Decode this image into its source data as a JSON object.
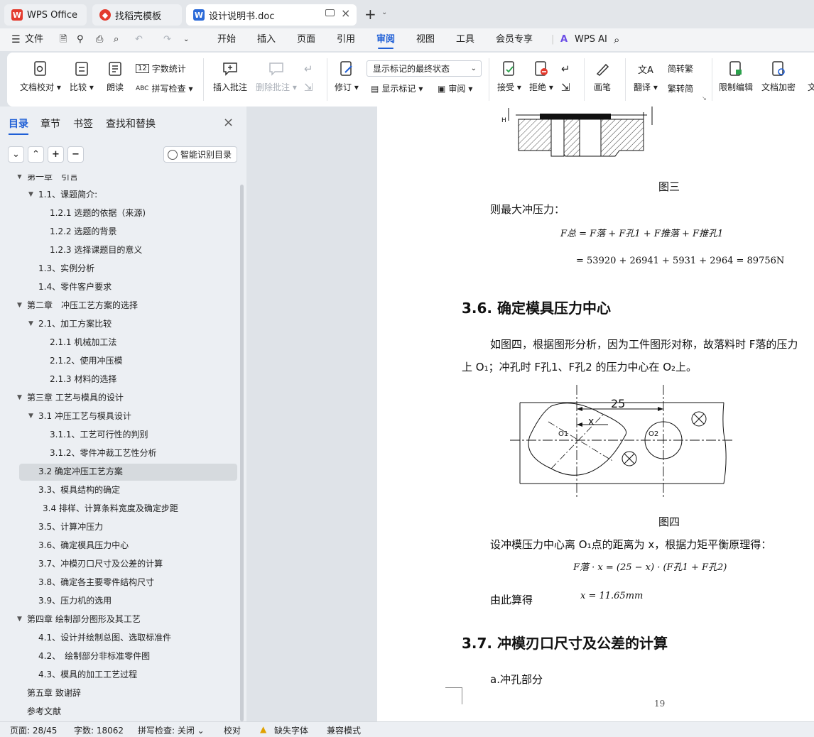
{
  "tabs": [
    {
      "label": "WPS Office"
    },
    {
      "label": "找稻壳模板"
    },
    {
      "label": "设计说明书.doc"
    }
  ],
  "menu": {
    "file": "文件",
    "items": [
      "开始",
      "插入",
      "页面",
      "引用",
      "审阅",
      "视图",
      "工具",
      "会员专享"
    ],
    "active": "审阅",
    "wps_ai": "WPS AI"
  },
  "ribbon": {
    "doc_check": "文档校对",
    "compare": "比较",
    "read_aloud": "朗读",
    "word_count": "字数统计",
    "spell_check": "拼写检查",
    "insert_comment": "插入批注",
    "delete_comment": "删除批注",
    "revise": "修订",
    "markup_state": "显示标记的最终状态",
    "show_markup": "显示标记",
    "review": "审阅",
    "accept": "接受",
    "reject": "拒绝",
    "pen": "画笔",
    "translate": "翻译",
    "to_traditional": "简转繁",
    "to_simplified": "繁转简",
    "restrict_edit": "限制编辑",
    "doc_encrypt": "文档加密",
    "more_cut": "文"
  },
  "nav_pane": {
    "tabs": [
      "目录",
      "章节",
      "书签",
      "查找和替换"
    ],
    "smart_toc": "智能识别目录",
    "toc": [
      {
        "label": "第一章　引言"
      },
      {
        "label": "1.1、课题简介:"
      },
      {
        "label": "1.2.1 选题的依据（来源)"
      },
      {
        "label": "1.2.2 选题的背景"
      },
      {
        "label": "1.2.3 选择课题目的意义"
      },
      {
        "label": "1.3、实例分析"
      },
      {
        "label": "1.4、零件客户要求"
      },
      {
        "label": "第二章　冲压工艺方案的选择"
      },
      {
        "label": "2.1、加工方案比较"
      },
      {
        "label": "2.1.1 机械加工法"
      },
      {
        "label": "2.1.2、使用冲压模"
      },
      {
        "label": "2.1.3 材料的选择"
      },
      {
        "label": "第三章 工艺与模具的设计"
      },
      {
        "label": "3.1 冲压工艺与模具设计"
      },
      {
        "label": "3.1.1、工艺可行性的判别"
      },
      {
        "label": "3.1.2、零件冲裁工艺性分析"
      },
      {
        "label": "3.2 确定冲压工艺方案"
      },
      {
        "label": "3.3、模具结构的确定"
      },
      {
        "label": "3.4 排样、计算条料宽度及确定步距"
      },
      {
        "label": "3.5、计算冲压力"
      },
      {
        "label": "3.6、确定模具压力中心"
      },
      {
        "label": "3.7、冲模刃口尺寸及公差的计算"
      },
      {
        "label": "3.8、确定各主要零件结构尺寸"
      },
      {
        "label": "3.9、压力机的选用"
      },
      {
        "label": "第四章 绘制部分图形及其工艺"
      },
      {
        "label": "4.1、设计并绘制总图、选取标准件"
      },
      {
        "label": "4.2、　绘制部分非标准零件图"
      },
      {
        "label": "4.3、模具的加工工艺过程"
      },
      {
        "label": "第五章 致谢辞"
      },
      {
        "label": "参考文献"
      }
    ]
  },
  "document": {
    "fig3_caption": "图三",
    "max_force_intro": "则最大冲压力：",
    "formula1_lhs": "F总 = F落 + F孔1 + F推落 + F推孔1",
    "formula1_rhs": "= 53920 + 26941 + 5931 + 2964 = 89756N",
    "heading_36": "3.6.  确定模具压力中心",
    "para_36_line1": "如图四，根据图形分析，因为工件图形对称，故落料时 F落的压力",
    "para_36_line2": "上 O₁；冲孔时 F孔1、F孔2 的压力中心在 O₂上。",
    "fig4_dim": "25",
    "fig4_x": "x",
    "fig4_o1": "O1",
    "fig4_o2": "O2",
    "fig4_caption": "图四",
    "para_x": "设冲模压力中心离 O₁点的距离为 x，根据力矩平衡原理得：",
    "formula2": "F落 · x = (25 − x) · (F孔1 + F孔2)",
    "result_label": "由此算得",
    "result_value": "x = 11.65mm",
    "heading_37": "3.7.  冲模刃口尺寸及公差的计算",
    "sub_a": "a.冲孔部分",
    "page_number": "19"
  },
  "status": {
    "page": "页面: 28/45",
    "words": "字数: 18062",
    "spell": "拼写检查: 关闭",
    "proof": "校对",
    "missing_font": "缺失字体",
    "compat": "兼容模式"
  },
  "colors": {
    "accent": "#1f5fd6",
    "wps_red": "#e33b2e",
    "doc_blue": "#2b6ad8"
  }
}
